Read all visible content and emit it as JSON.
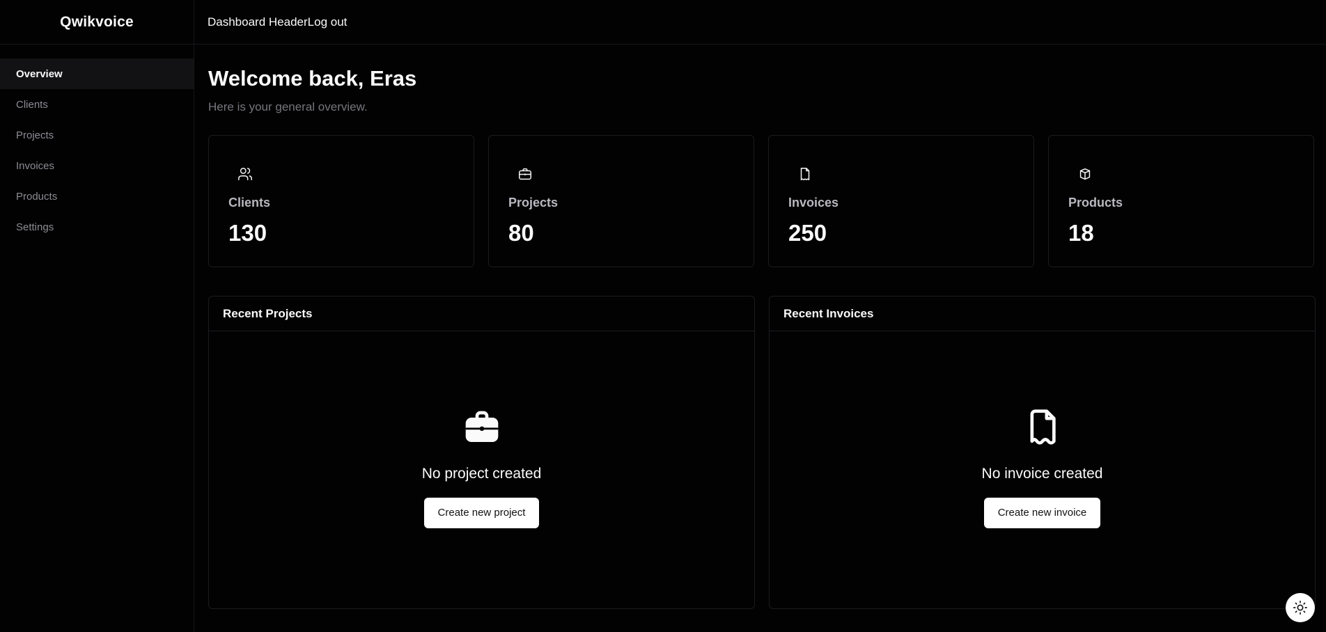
{
  "sidebar": {
    "brand": "Qwikvoice",
    "items": [
      {
        "label": "Overview",
        "active": true
      },
      {
        "label": "Clients"
      },
      {
        "label": "Projects"
      },
      {
        "label": "Invoices"
      },
      {
        "label": "Products"
      },
      {
        "label": "Settings"
      }
    ]
  },
  "header": {
    "title": "Dashboard Header",
    "logout_label": "Log out"
  },
  "main": {
    "welcome": "Welcome back, Eras",
    "subtitle": "Here is your general overview.",
    "stats": [
      {
        "label": "Clients",
        "value": "130",
        "icon": "users-icon"
      },
      {
        "label": "Projects",
        "value": "80",
        "icon": "briefcase-icon"
      },
      {
        "label": "Invoices",
        "value": "250",
        "icon": "receipt-icon"
      },
      {
        "label": "Products",
        "value": "18",
        "icon": "package-icon"
      }
    ],
    "panels": {
      "projects": {
        "title": "Recent Projects",
        "empty_text": "No project created",
        "button_label": "Create new project",
        "icon": "briefcase-icon"
      },
      "invoices": {
        "title": "Recent Invoices",
        "empty_text": "No invoice created",
        "button_label": "Create new invoice",
        "icon": "receipt-icon"
      }
    }
  },
  "theme_toggle": {
    "icon": "sun-icon"
  },
  "colors": {
    "background": "#020203",
    "border": "#1c1c20",
    "text": "#fafafa",
    "muted": "#8c8c93",
    "button_bg": "#ffffff"
  }
}
